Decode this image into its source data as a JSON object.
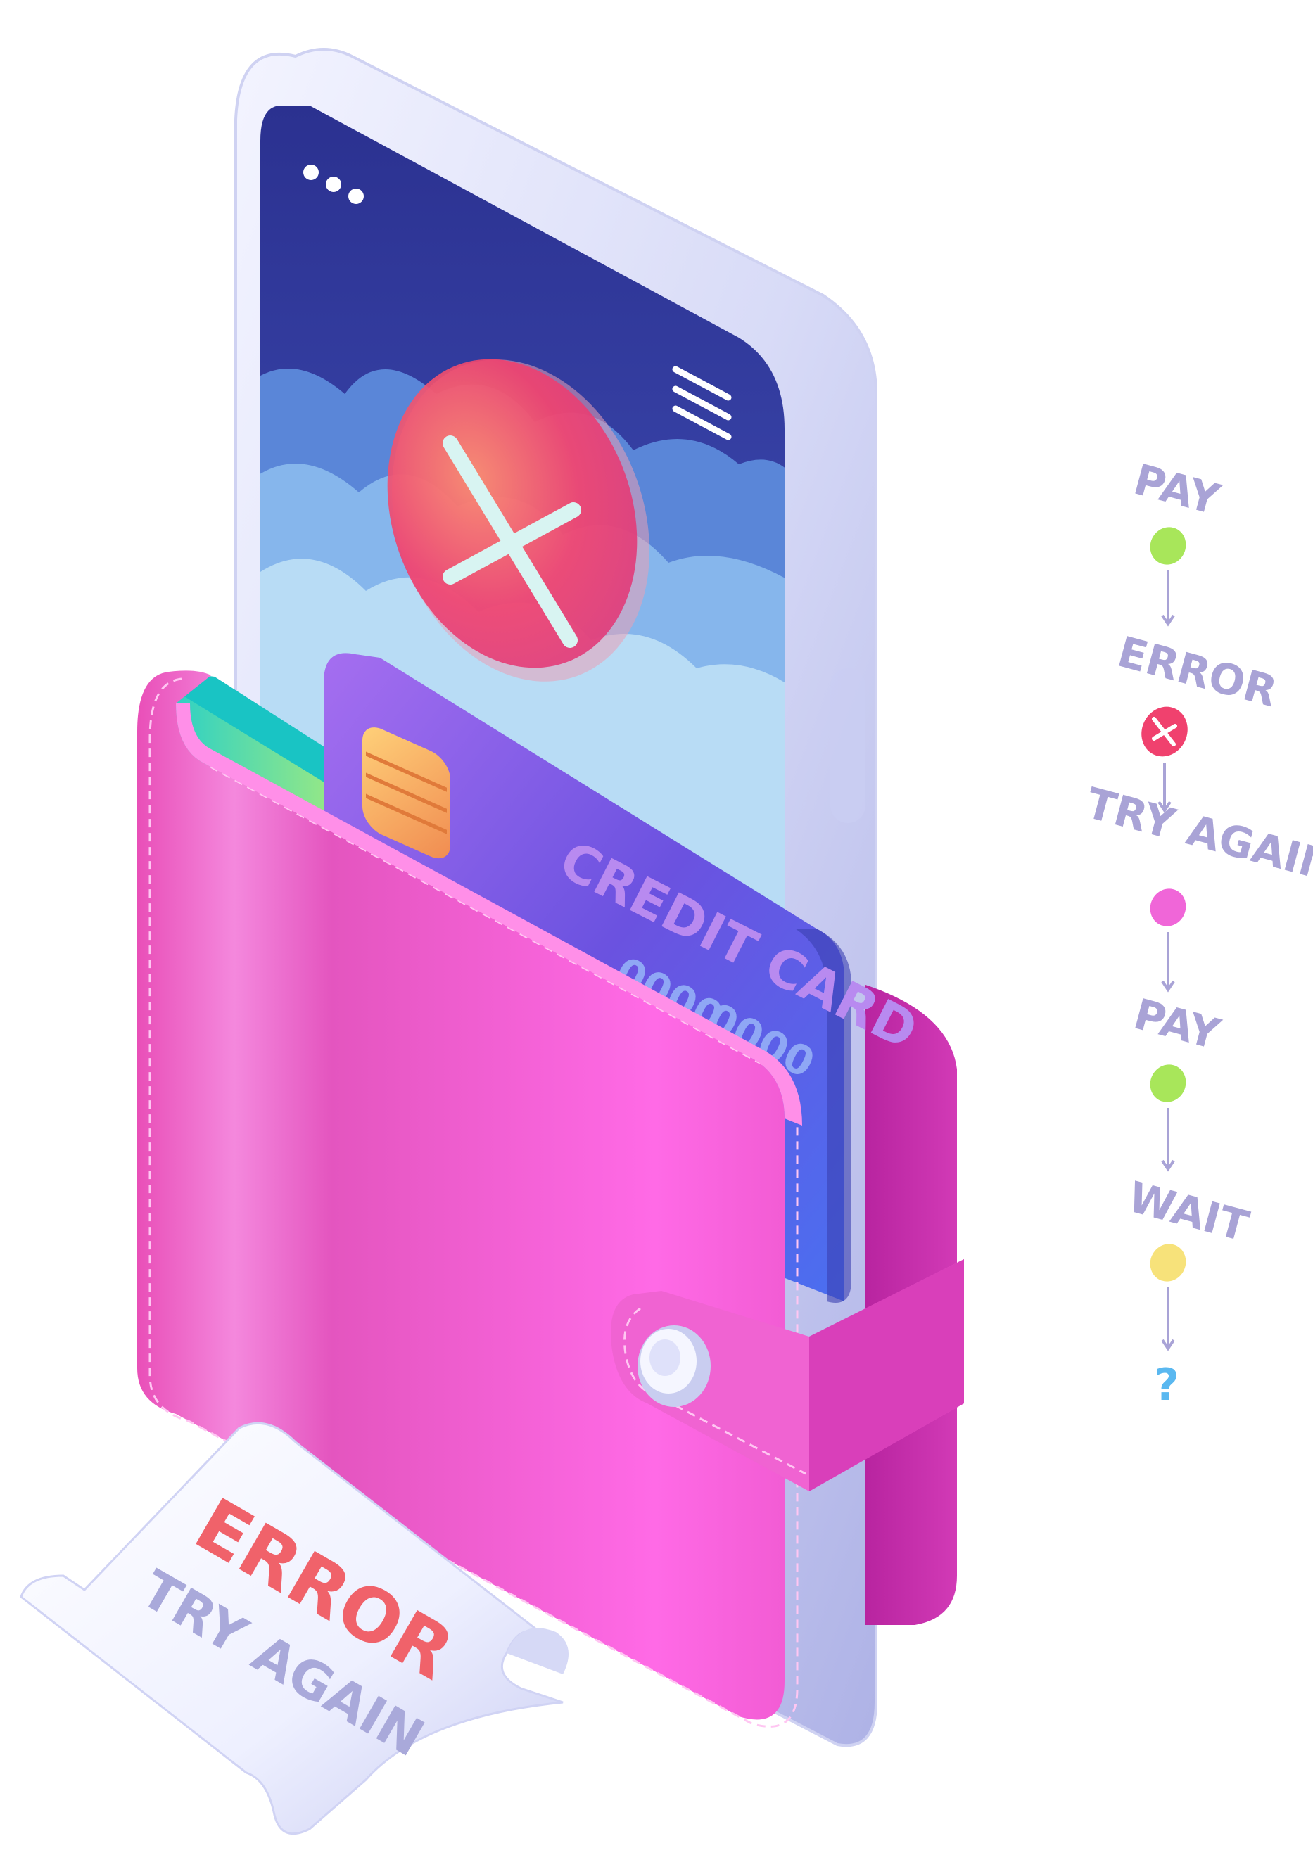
{
  "illustration": {
    "card": {
      "label": "CREDIT CARD",
      "number_group_1": "0000",
      "number_group_2": "0000"
    },
    "receipt": {
      "line1": "ERROR",
      "line2": "TRY AGAIN"
    },
    "phone": {
      "status_icon": "x-mark-icon",
      "menu_icon": "hamburger-menu-icon",
      "dots_icon": "three-dots-icon"
    }
  },
  "flow": {
    "steps": [
      {
        "label": "PAY",
        "dot_color": "#a8e65a"
      },
      {
        "label": "ERROR",
        "dot_color": "#f0416e"
      },
      {
        "label": "TRY AGAIN",
        "dot_color": "#f066d8"
      },
      {
        "label": "PAY",
        "dot_color": "#a8e65a"
      },
      {
        "label": "WAIT",
        "dot_color": "#f7e27a"
      }
    ],
    "end_label": "?"
  },
  "colors": {
    "wallet": "#ea4fc7",
    "card": "#6c5be0",
    "screen_top": "#2d3597",
    "error": "#f0416e",
    "flow_text": "#a9a3d6",
    "question": "#5ab8f0"
  }
}
